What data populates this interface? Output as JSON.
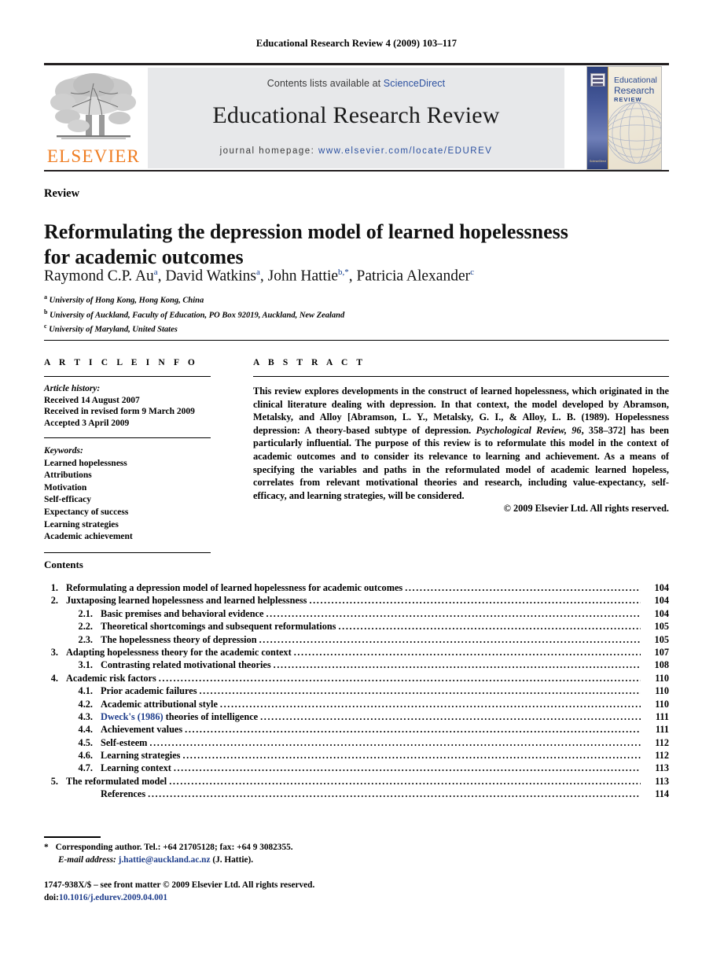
{
  "running_head": "Educational Research Review 4 (2009) 103–117",
  "masthead": {
    "contents_prefix": "Contents lists available at ",
    "contents_link": "ScienceDirect",
    "journal_title": "Educational Research Review",
    "homepage_prefix": "journal homepage:",
    "homepage_url": "www.elsevier.com/locate/EDUREV",
    "publisher_wordmark": "ELSEVIER",
    "cover": {
      "line1": "Educational",
      "line2": "Research",
      "line3": "REVIEW",
      "spine_footer": "ScienceDirect"
    }
  },
  "article": {
    "doctype": "Review",
    "title": "Reformulating the depression model of learned hopelessness for academic outcomes",
    "authors": [
      {
        "name": "Raymond C.P. Au",
        "marks": "a"
      },
      {
        "name": "David Watkins",
        "marks": "a"
      },
      {
        "name": "John Hattie",
        "marks": "b,*"
      },
      {
        "name": "Patricia Alexander",
        "marks": "c"
      }
    ],
    "affiliations": [
      {
        "mark": "a",
        "text": "University of Hong Kong, Hong Kong, China"
      },
      {
        "mark": "b",
        "text": "University of Auckland, Faculty of Education, PO Box 92019, Auckland, New Zealand"
      },
      {
        "mark": "c",
        "text": "University of Maryland, United States"
      }
    ]
  },
  "info": {
    "heading": "A R T I C L E  I N F O",
    "history_label": "Article history:",
    "history": [
      "Received 14 August 2007",
      "Received in revised form 9 March 2009",
      "Accepted 3 April 2009"
    ],
    "keywords_label": "Keywords:",
    "keywords": [
      "Learned hopelessness",
      "Attributions",
      "Motivation",
      "Self-efficacy",
      "Expectancy of success",
      "Learning strategies",
      "Academic achievement"
    ]
  },
  "abstract": {
    "heading": "A B S T R A C T",
    "part1": "This review explores developments in the construct of learned hopelessness, which originated in the clinical literature dealing with depression. In that context, the model developed by Abramson, Metalsky, and Alloy [Abramson, L. Y., Metalsky, G. I., & Alloy, L. B. (1989). Hopelessness depression: A theory-based subtype of depression. ",
    "italic1": "Psychological Review, 96",
    "part2": ", 358–372] has been particularly influential. The purpose of this review is to reformulate this model in the context of academic outcomes and to consider its relevance to learning and achievement. As a means of specifying the variables and paths in the reformulated model of academic learned hopeless, correlates from relevant motivational theories and research, including value-expectancy, self-efficacy, and learning strategies, will be considered.",
    "copyright": "© 2009 Elsevier Ltd. All rights reserved."
  },
  "contents": {
    "heading": "Contents",
    "entries": [
      {
        "level": 1,
        "num": "1.",
        "label": "Reformulating a depression model of learned hopelessness for academic outcomes",
        "page": "104"
      },
      {
        "level": 1,
        "num": "2.",
        "label": "Juxtaposing learned hopelessness and learned helplessness",
        "page": "104"
      },
      {
        "level": 2,
        "num": "2.1.",
        "label": "Basic premises and behavioral evidence",
        "page": "104"
      },
      {
        "level": 2,
        "num": "2.2.",
        "label": "Theoretical shortcomings and subsequent reformulations",
        "page": "105"
      },
      {
        "level": 2,
        "num": "2.3.",
        "label": "The hopelessness theory of depression",
        "page": "105"
      },
      {
        "level": 1,
        "num": "3.",
        "label": "Adapting hopelessness theory for the academic context",
        "page": "107"
      },
      {
        "level": 2,
        "num": "3.1.",
        "label": "Contrasting related motivational theories",
        "page": "108"
      },
      {
        "level": 1,
        "num": "4.",
        "label": "Academic risk factors",
        "page": "110"
      },
      {
        "level": 2,
        "num": "4.1.",
        "label": "Prior academic failures",
        "page": "110"
      },
      {
        "level": 2,
        "num": "4.2.",
        "label": "Academic attributional style",
        "page": "110"
      },
      {
        "level": 2,
        "num": "4.3.",
        "label": "Dweck's (1986) theories of intelligence",
        "link_prefix": "Dweck's (1986)",
        "page": "111"
      },
      {
        "level": 2,
        "num": "4.4.",
        "label": "Achievement values",
        "page": "111"
      },
      {
        "level": 2,
        "num": "4.5.",
        "label": "Self-esteem",
        "page": "112"
      },
      {
        "level": 2,
        "num": "4.6.",
        "label": "Learning strategies",
        "page": "112"
      },
      {
        "level": 2,
        "num": "4.7.",
        "label": "Learning context",
        "page": "113"
      },
      {
        "level": 1,
        "num": "5.",
        "label": "The reformulated model",
        "page": "113"
      },
      {
        "level": 2,
        "num": "",
        "label": "References",
        "page": "114"
      }
    ]
  },
  "footnotes": {
    "star": "*",
    "corresponding": "Corresponding author. Tel.: +64 21705128; fax: +64 9 3082355.",
    "email_label": "E-mail address:",
    "email": "j.hattie@auckland.ac.nz",
    "email_suffix": "(J. Hattie).",
    "imprint_line": "1747-938X/$ – see front matter © 2009 Elsevier Ltd. All rights reserved.",
    "doi_label": "doi:",
    "doi": "10.1016/j.edurev.2009.04.001"
  }
}
